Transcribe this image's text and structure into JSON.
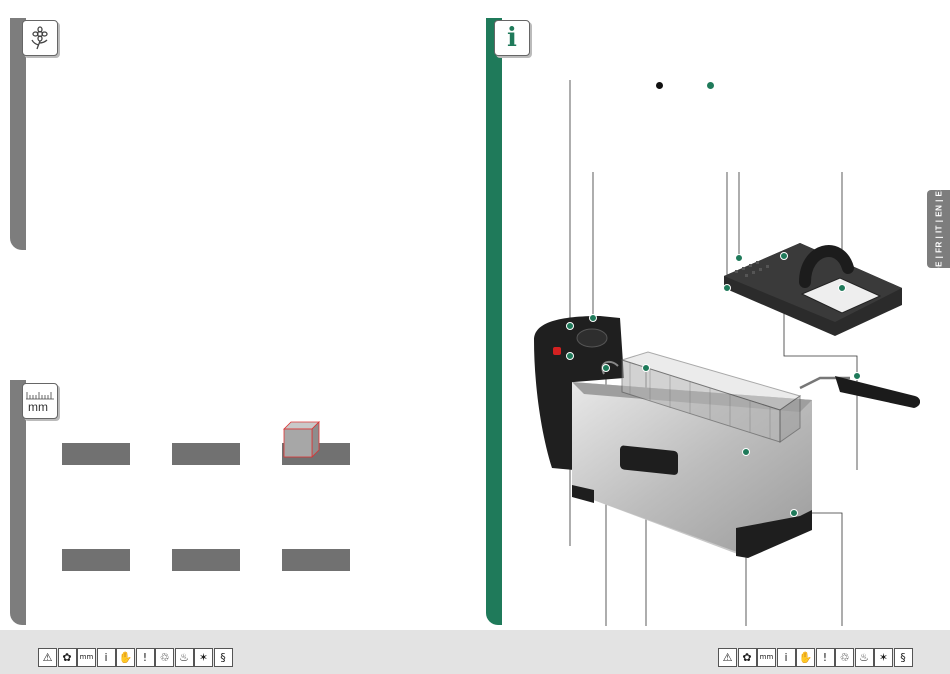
{
  "language_tab": {
    "label": "DE | FR | IT | EN | ES"
  },
  "legend": {
    "dot_colors": [
      "#111111",
      "#1f7a5a"
    ]
  },
  "icons": {
    "left_panel_top": "flower-icon",
    "left_panel_bottom": "ruler-icon",
    "right_panel": "info-icon"
  },
  "measure_unit": "mm",
  "info_letter": "i",
  "footer_icons": [
    {
      "name": "warning-icon",
      "glyph": "⚠"
    },
    {
      "name": "flower-icon",
      "glyph": "✿"
    },
    {
      "name": "ruler-icon",
      "glyph": "mm"
    },
    {
      "name": "info-icon",
      "glyph": "i"
    },
    {
      "name": "hand-icon",
      "glyph": "✋"
    },
    {
      "name": "exclamation-icon",
      "glyph": "!"
    },
    {
      "name": "recycle-icon",
      "glyph": "♲"
    },
    {
      "name": "cooking-icon",
      "glyph": "♨"
    },
    {
      "name": "snowflake-icon",
      "glyph": "✶"
    },
    {
      "name": "section-icon",
      "glyph": "§"
    }
  ]
}
